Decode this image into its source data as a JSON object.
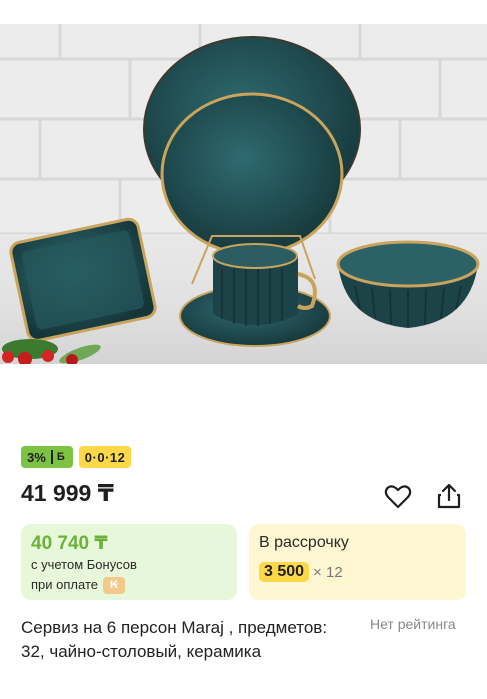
{
  "product": {
    "image_alt": "Dark teal ceramic tableware set with gold rim",
    "bonus_badge": "3%",
    "installment_badge": "0·0·12",
    "price": "41 999 ₸",
    "title": "Сервиз на 6 персон Maraj , предметов: 32, чайно-столовый, керамика",
    "rating_text": "Нет рейтинга"
  },
  "bonus_card": {
    "price": "40 740 ₸",
    "line1": "с учетом Бонусов",
    "line2": "при оплате"
  },
  "installment_card": {
    "title": "В рассрочку",
    "amount": "3 500",
    "months": "× 12"
  },
  "icons": {
    "favorite": "heart-icon",
    "share": "share-icon",
    "bonus": "bonus-b-icon",
    "payment": "kaspi-coin-icon"
  },
  "colors": {
    "bonus_green": "#7cc243",
    "installment_yellow": "#ffd84a",
    "bonus_card_bg": "#e7f7da",
    "installment_card_bg": "#fff6d2",
    "dish_teal": "#1f4a4f",
    "gold_rim": "#c9a45c"
  }
}
